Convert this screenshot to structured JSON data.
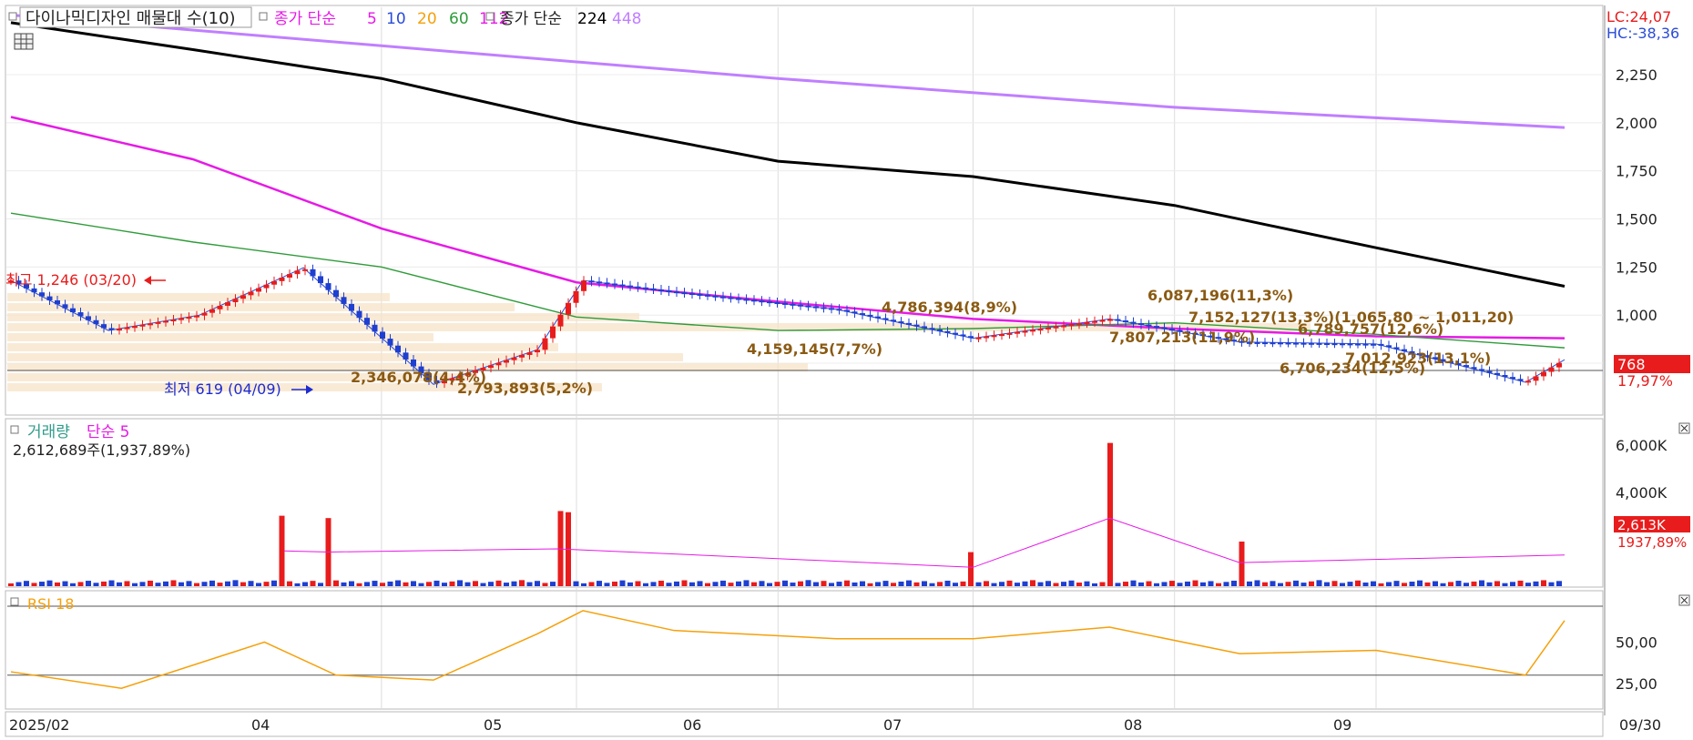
{
  "title_bar": {
    "stock_label": "다이나믹디자인 매물대 수(10)",
    "ma_label": "종가 단순",
    "ma_periods": [
      "5",
      "10",
      "20",
      "60",
      "112"
    ],
    "ma_colors": [
      "#e61ae6",
      "#2a4bd7",
      "#f5a00a",
      "#2f9b3a",
      "#e61ae6"
    ],
    "ma2_label": "종가 단순",
    "ma2_periods": [
      "224",
      "448"
    ],
    "ma2_colors": [
      "#000000",
      "#c07fff"
    ]
  },
  "top_right": {
    "lc": "LC:24,07",
    "hc": "HC:-38,36"
  },
  "price_badge": {
    "value": "768",
    "pct": "17,97%"
  },
  "annotations": {
    "high": "최고 1,246 (03/20)",
    "low": "최저 619 (04/09)",
    "vp_labels": [
      "4,786,394(8,9%)",
      "6,087,196(11,3%)",
      "7,152,127(13,3%)(1,065,80 ~ 1,011,20)",
      "6,789,757(12,6%)",
      "7,807,213(11,9%)",
      "4,159,145(7,7%)",
      "7,012,923(13,1%)",
      "6,706,234(12,5%)",
      "2,346,078(4,4%)",
      "2,793,893(5,2%)"
    ]
  },
  "volume_panel": {
    "title": "거래량",
    "ma_label": "단순 5",
    "info": "2,612,689주(1,937,89%)",
    "badge_value": "2,613K",
    "badge_pct": "1937,89%"
  },
  "rsi_panel": {
    "title": "RSI 18"
  },
  "x_axis": {
    "ticks": [
      "2025/02",
      "04",
      "05",
      "06",
      "07",
      "08",
      "09"
    ],
    "last": "09/30"
  },
  "chart_data": [
    {
      "type": "line",
      "title": "다이나믹디자인",
      "series": [
        {
          "name": "224",
          "x": [
            "2025-02-03",
            "2025-03-03",
            "2025-04-01",
            "2025-05-01",
            "2025-06-01",
            "2025-07-01",
            "2025-08-01",
            "2025-09-01",
            "2025-09-30"
          ],
          "values": [
            2520,
            2380,
            2230,
            2000,
            1800,
            1720,
            1570,
            1350,
            1150
          ]
        },
        {
          "name": "448",
          "x": [
            "2025-02-03",
            "2025-04-01",
            "2025-06-01",
            "2025-08-01",
            "2025-09-30"
          ],
          "values": [
            2560,
            2400,
            2230,
            2080,
            1975
          ]
        },
        {
          "name": "112",
          "x": [
            "2025-02-03",
            "2025-03-03",
            "2025-04-01",
            "2025-05-01",
            "2025-06-01",
            "2025-07-01",
            "2025-08-01",
            "2025-09-01",
            "2025-09-30"
          ],
          "values": [
            2030,
            1810,
            1450,
            1170,
            1070,
            980,
            930,
            890,
            880
          ]
        },
        {
          "name": "60",
          "x": [
            "2025-02-03",
            "2025-03-03",
            "2025-04-01",
            "2025-05-01",
            "2025-06-01",
            "2025-07-01",
            "2025-08-01",
            "2025-09-01",
            "2025-09-30"
          ],
          "values": [
            1530,
            1380,
            1250,
            990,
            920,
            930,
            960,
            900,
            830
          ]
        }
      ],
      "ohlc_close": {
        "x": [
          "2025-02-03",
          "2025-02-18",
          "2025-03-04",
          "2025-03-20",
          "2025-04-09",
          "2025-04-25",
          "2025-05-02",
          "2025-05-16",
          "2025-06-10",
          "2025-07-01",
          "2025-07-22",
          "2025-08-11",
          "2025-09-01",
          "2025-09-24",
          "2025-09-30"
        ],
        "values": [
          1180,
          920,
          1000,
          1246,
          640,
          820,
          1180,
          1120,
          1030,
          880,
          980,
          860,
          850,
          651,
          768
        ]
      },
      "annotations": [
        {
          "x": "2025-03-20",
          "y": 1246,
          "text": "최고 1,246 (03/20)"
        },
        {
          "x": "2025-04-09",
          "y": 619,
          "text": "최저 619 (04/09)"
        }
      ],
      "y_ticks": [
        "2,250",
        "2,000",
        "1,750",
        "1,500",
        "1,250",
        "1,000",
        "750"
      ],
      "ylim": [
        490,
        2600
      ],
      "x_ticks": [
        "2025/02",
        "04",
        "05",
        "06",
        "07",
        "08",
        "09"
      ],
      "legend": "top-left"
    },
    {
      "type": "bar",
      "title": "거래량",
      "x": [
        "2025-03-17",
        "2025-03-24",
        "2025-04-28",
        "2025-04-30",
        "2025-07-01",
        "2025-07-22",
        "2025-08-11",
        "2025-09-30"
      ],
      "values": [
        3000,
        2900,
        3200,
        3150,
        1450,
        6100,
        1900,
        2613
      ],
      "y_ticks": [
        "6,000K",
        "4,000K"
      ],
      "ylim": [
        0,
        6900
      ]
    },
    {
      "type": "line",
      "title": "RSI 18",
      "x": [
        "2025-02-03",
        "2025-02-20",
        "2025-03-14",
        "2025-03-25",
        "2025-04-09",
        "2025-04-25",
        "2025-05-02",
        "2025-05-16",
        "2025-06-10",
        "2025-07-01",
        "2025-07-22",
        "2025-08-11",
        "2025-09-01",
        "2025-09-24",
        "2025-09-30"
      ],
      "values": [
        32,
        22,
        50,
        30,
        27,
        55,
        69,
        57,
        52,
        52,
        59,
        43,
        45,
        30,
        63
      ],
      "y_ticks": [
        "50,00",
        "25,00"
      ],
      "reference_line": 30
    }
  ]
}
